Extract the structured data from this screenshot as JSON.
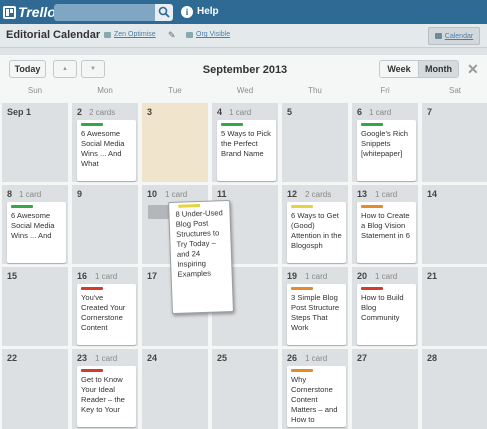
{
  "topbar": {
    "logo": "Trello",
    "search_placeholder": "",
    "help": "Help"
  },
  "board": {
    "title": "Editorial Calendar",
    "org": "Zen Optimise",
    "visibility": "Org Visible",
    "calendar_btn": "Calendar"
  },
  "calendar": {
    "today_btn": "Today",
    "prev": "▲",
    "next": "▼",
    "month": "September 2013",
    "week": "Week",
    "month_btn": "Month",
    "close": "✕",
    "weekdays": [
      "Sun",
      "Mon",
      "Tue",
      "Wed",
      "Thu",
      "Fri",
      "Sat"
    ],
    "cells": [
      [
        {
          "day": "Sep 1"
        },
        {
          "day": "2",
          "count": "2 cards",
          "card": "6 Awesome Social Media Wins ... And What",
          "color": "green"
        },
        {
          "day": "3",
          "today": true
        },
        {
          "day": "4",
          "count": "1 card",
          "card": "5 Ways to Pick the Perfect Brand Name",
          "color": "green"
        },
        {
          "day": "5"
        },
        {
          "day": "6",
          "count": "1 card",
          "card": "Google's Rich Snippets [whitepaper]",
          "color": "green"
        },
        {
          "day": "7"
        }
      ],
      [
        {
          "day": "8",
          "count": "1 card",
          "card": "6 Awesome Social Media Wins ... And",
          "color": "green"
        },
        {
          "day": "9"
        },
        {
          "day": "10",
          "count": "1 card"
        },
        {
          "day": "11"
        },
        {
          "day": "12",
          "count": "2 cards",
          "card": "6 Ways to Get (Good) Attention in the Blogosph",
          "color": "yellow"
        },
        {
          "day": "13",
          "count": "1 card",
          "card": "How to Create a Blog Vision Statement in 6",
          "color": "orange"
        },
        {
          "day": "14"
        }
      ],
      [
        {
          "day": "15"
        },
        {
          "day": "16",
          "count": "1 card",
          "card": "You've Created Your Cornerstone Content",
          "color": "red"
        },
        {
          "day": "17"
        },
        {
          "day": "18"
        },
        {
          "day": "19",
          "count": "1 card",
          "card": "3 Simple Blog Post Structure Steps That Work",
          "color": "orange"
        },
        {
          "day": "20",
          "count": "1 card",
          "card": "How to Build Blog Community",
          "color": "red"
        },
        {
          "day": "21"
        }
      ],
      [
        {
          "day": "22"
        },
        {
          "day": "23",
          "count": "1 card",
          "card": "Get to Know Your Ideal Reader – the Key to Your",
          "color": "red"
        },
        {
          "day": "24"
        },
        {
          "day": "25"
        },
        {
          "day": "26",
          "count": "1 card",
          "card": "Why Cornerstone Content Matters – and How to",
          "color": "orange"
        },
        {
          "day": "27"
        },
        {
          "day": "28"
        }
      ]
    ],
    "dragging_card": {
      "text": "8 Under-Used Blog Post Structures to Try Today – and 24 Inspiring Examples",
      "color": "yellow"
    }
  },
  "colors": {
    "topbar": "#2e6a94",
    "green": "#33a84a",
    "orange": "#e88a2a",
    "red": "#d33b2b",
    "yellow": "#e6d43b"
  }
}
